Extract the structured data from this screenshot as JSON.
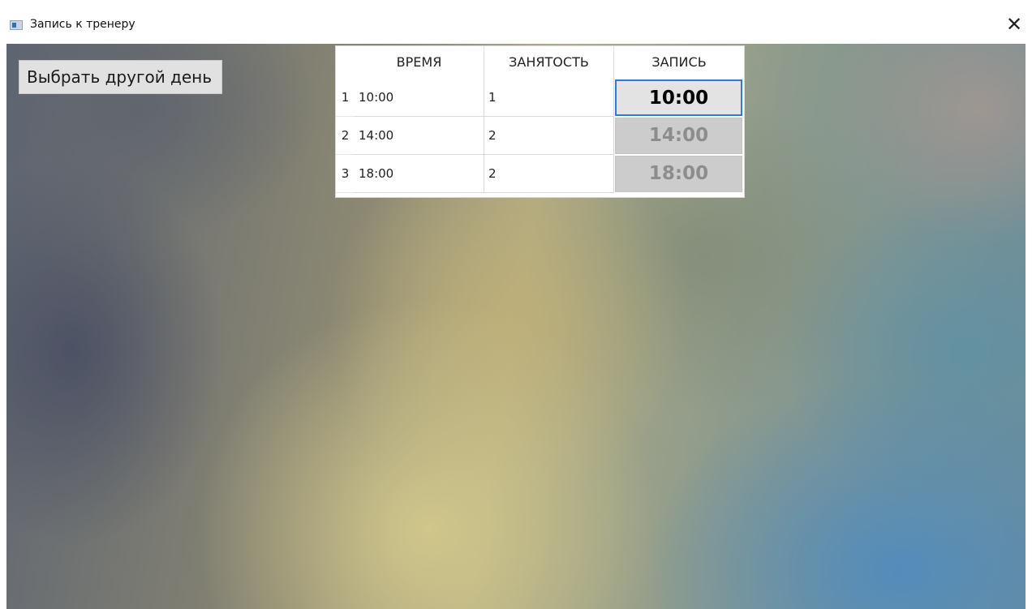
{
  "window": {
    "title": "Запись к тренеру",
    "close_glyph": "✕",
    "app_icon": "window-app-icon"
  },
  "toolbar": {
    "other_day_label": "Выбрать другой день"
  },
  "table": {
    "columns": [
      "ВРЕМЯ",
      "ЗАНЯТОСТЬ",
      "ЗАПИСЬ"
    ],
    "rows": [
      {
        "index": "1",
        "time": "10:00",
        "occupancy": "1",
        "booking": "10:00",
        "booking_enabled": true
      },
      {
        "index": "2",
        "time": "14:00",
        "occupancy": "2",
        "booking": "14:00",
        "booking_enabled": false
      },
      {
        "index": "3",
        "time": "18:00",
        "occupancy": "2",
        "booking": "18:00",
        "booking_enabled": false
      }
    ]
  },
  "colors": {
    "focus_border": "#2e7bcf",
    "disabled_text": "#8d8d8d",
    "button_bg": "#e1e1e1"
  }
}
